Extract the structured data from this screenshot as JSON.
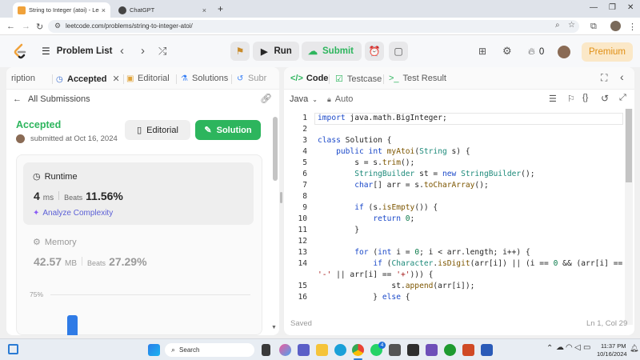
{
  "browser": {
    "tabs": [
      {
        "title": "String to Integer (atoi) - LeetCo",
        "active": true
      },
      {
        "title": "ChatGPT",
        "active": false
      }
    ],
    "new_tab": "+",
    "url": "leetcode.com/problems/string-to-integer-atoi/"
  },
  "topbar": {
    "problem_list": "Problem List",
    "run": "Run",
    "submit": "Submit",
    "fire_count": "0",
    "premium": "Premium"
  },
  "left_panel": {
    "tabs": [
      "ription",
      "Accepted",
      "Editorial",
      "Solutions",
      "Subr"
    ],
    "all_submissions": "All Submissions",
    "status": "Accepted",
    "submitted_at": "submitted at Oct 16, 2024",
    "editorial_btn": "Editorial",
    "solution_btn": "Solution",
    "runtime": {
      "label": "Runtime",
      "value": "4",
      "unit": "ms",
      "beats_label": "Beats",
      "beats_value": "11.56%"
    },
    "analyze": "Analyze Complexity",
    "memory": {
      "label": "Memory",
      "value": "42.57",
      "unit": "MB",
      "beats_label": "Beats",
      "beats_value": "27.29%"
    },
    "chart_tick": "75%"
  },
  "right_panel": {
    "tabs": [
      "Code",
      "Testcase",
      "Test Result"
    ],
    "language": "Java",
    "mode": "Auto",
    "status_saved": "Saved",
    "cursor_pos": "Ln 1, Col 29",
    "lines": [
      {
        "n": "1",
        "code": "import java.math.BigInteger;"
      },
      {
        "n": "2",
        "code": ""
      },
      {
        "n": "3",
        "code": "class Solution {"
      },
      {
        "n": "4",
        "code": "    public int myAtoi(String s) {"
      },
      {
        "n": "5",
        "code": "        s = s.trim();"
      },
      {
        "n": "6",
        "code": "        StringBuilder st = new StringBuilder();"
      },
      {
        "n": "7",
        "code": "        char[] arr = s.toCharArray();"
      },
      {
        "n": "8",
        "code": ""
      },
      {
        "n": "9",
        "code": "        if (s.isEmpty()) {"
      },
      {
        "n": "10",
        "code": "            return 0;"
      },
      {
        "n": "11",
        "code": "        }"
      },
      {
        "n": "12",
        "code": ""
      },
      {
        "n": "13",
        "code": "        for (int i = 0; i < arr.length; i++) {"
      },
      {
        "n": "14",
        "code": "            if (Character.isDigit(arr[i]) || (i == 0 && (arr[i] =="
      },
      {
        "n": "",
        "code": "'-' || arr[i] == '+'))) {"
      },
      {
        "n": "15",
        "code": "                st.append(arr[i]);"
      },
      {
        "n": "16",
        "code": "            } else {"
      }
    ]
  },
  "taskbar": {
    "search": "Search",
    "time": "11:37 PM",
    "date": "10/16/2024",
    "notification_badge": "4"
  },
  "colors": {
    "accepted": "#2db55d",
    "premium_text": "#e08f14",
    "keyword": "#1b49c9"
  }
}
